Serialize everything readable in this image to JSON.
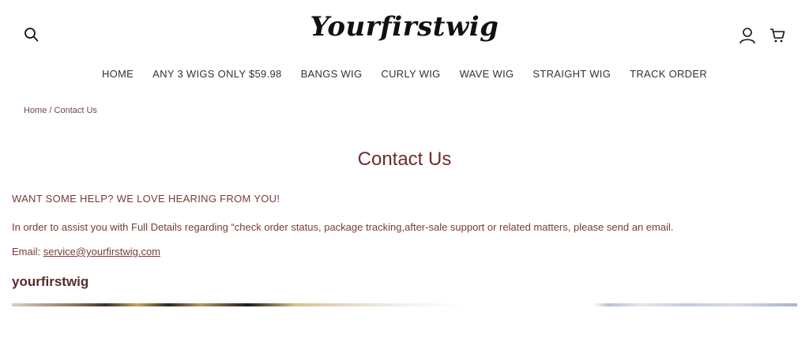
{
  "header": {
    "logo_text": "Yourfirstwig",
    "icons": {
      "search": "search-icon",
      "account": "user-icon",
      "cart": "cart-icon"
    }
  },
  "nav": {
    "items": [
      {
        "label": "HOME"
      },
      {
        "label": "ANY 3 WIGS ONLY $59.98"
      },
      {
        "label": "BANGS WIG"
      },
      {
        "label": "CURLY WIG"
      },
      {
        "label": "WAVE WIG"
      },
      {
        "label": "STRAIGHT WIG"
      },
      {
        "label": "TRACK ORDER"
      }
    ]
  },
  "breadcrumb": {
    "home": "Home",
    "separator": " / ",
    "current": "Contact Us"
  },
  "page": {
    "title": "Contact Us",
    "help_heading": "WANT SOME HELP? WE LOVE HEARING FROM YOU!",
    "assist_text": "In order to assist you with Full Details regarding “check order status, package tracking,after-sale support or related matters, please send an email.",
    "email_label": "Email: ",
    "email": "service@yourfirstwig.com",
    "brand_heading": "yourfirstwig"
  },
  "colors": {
    "accent": "#6b2e2e",
    "text": "#7a3b3b",
    "nav_text": "#333333"
  }
}
